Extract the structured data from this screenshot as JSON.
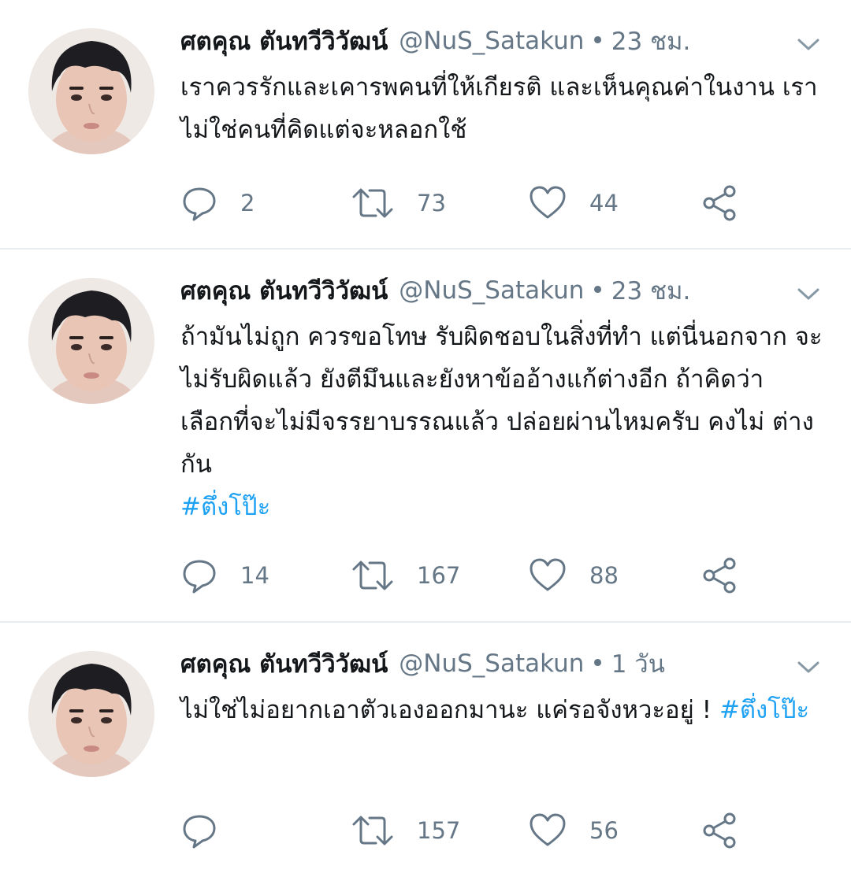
{
  "colors": {
    "text": "#14171a",
    "secondary": "#657786",
    "hashtag": "#1da1f2",
    "divider": "#e6ecf0"
  },
  "icons": {
    "reply": "reply-icon",
    "retweet": "retweet-icon",
    "like": "like-icon",
    "share": "share-icon",
    "menu": "chevron-down-icon"
  },
  "tweets": [
    {
      "name": "ศตคุณ ตันทวีวิวัฒน์",
      "handle": "@NuS_Satakun",
      "separator": "•",
      "time": "23 ชม.",
      "text": "เราควรรักและเคารพคนที่ให้เกียรติ และเห็นคุณค่าในงาน เรา ไม่ใช่คนที่คิดแต่จะหลอกใช้",
      "hashtag": "",
      "replies": "2",
      "retweets": "73",
      "likes": "44"
    },
    {
      "name": "ศตคุณ ตันทวีวิวัฒน์",
      "handle": "@NuS_Satakun",
      "separator": "•",
      "time": "23 ชม.",
      "text": "ถ้ามันไม่ถูก ควรขอโทษ รับผิดชอบในสิ่งที่ทำ แต่นี่นอกจาก จะไม่รับผิดแล้ว ยังตีมึนและยังหาข้ออ้างแก้ต่างอีก ถ้าคิดว่า เลือกที่จะไม่มีจรรยาบรรณแล้ว ปล่อยผ่านไหมครับ คงไม่ ต่างกัน",
      "hashtag": "#ตึ่งโป๊ะ",
      "replies": "14",
      "retweets": "167",
      "likes": "88"
    },
    {
      "name": "ศตคุณ ตันทวีวิวัฒน์",
      "handle": "@NuS_Satakun",
      "separator": "•",
      "time": "1 วัน",
      "text": "ไม่ใช่ไม่อยากเอาตัวเองออกมานะ แค่รอจังหวะอยู่ ! ",
      "hashtag": "#ตึ่งโป๊ะ",
      "replies": "",
      "retweets": "157",
      "likes": "56"
    }
  ]
}
